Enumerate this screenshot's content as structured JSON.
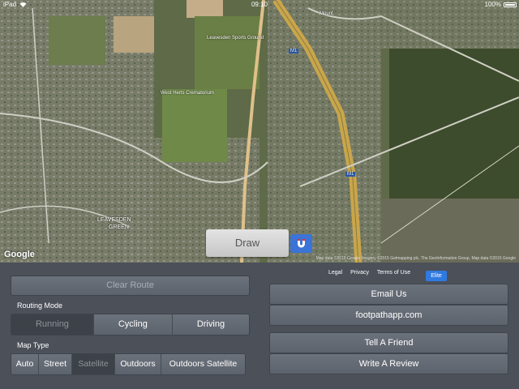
{
  "status_bar": {
    "device": "iPad",
    "time": "09:10",
    "battery": "100%"
  },
  "map": {
    "labels": {
      "sports_ground": "Leavesden Sports Ground",
      "crematorium": "West Herts Crematorium",
      "leavesden": "LEAVESDEN",
      "green": "GREEN",
      "mount": "Mount",
      "m1_a": "M1",
      "m1_b": "M1"
    },
    "google_logo": "Google",
    "attribution": "Map data ©2015 Google  Imagery ©2015 Getmapping plc, The GeoInformation Group, Map data ©2015 Google",
    "draw_label": "Draw",
    "magnet_icon": "magnet-icon"
  },
  "panel": {
    "clear_route": "Clear Route",
    "routing_mode_label": "Routing Mode",
    "routing_modes": [
      "Running",
      "Cycling",
      "Driving"
    ],
    "routing_selected": "Running",
    "map_type_label": "Map Type",
    "map_types": [
      "Auto",
      "Street",
      "Satellite",
      "Outdoors",
      "Outdoors Satellite"
    ],
    "map_type_selected": "Satellite",
    "links": {
      "legal": "Legal",
      "privacy": "Privacy",
      "terms": "Terms of Use",
      "elite": "Elite"
    },
    "email_us": "Email Us",
    "website": "footpathapp.com",
    "tell_friend": "Tell A Friend",
    "write_review": "Write A Review"
  },
  "colors": {
    "accent": "#3b74d6",
    "panel_bg": "#4b5059",
    "button": "#636972"
  }
}
